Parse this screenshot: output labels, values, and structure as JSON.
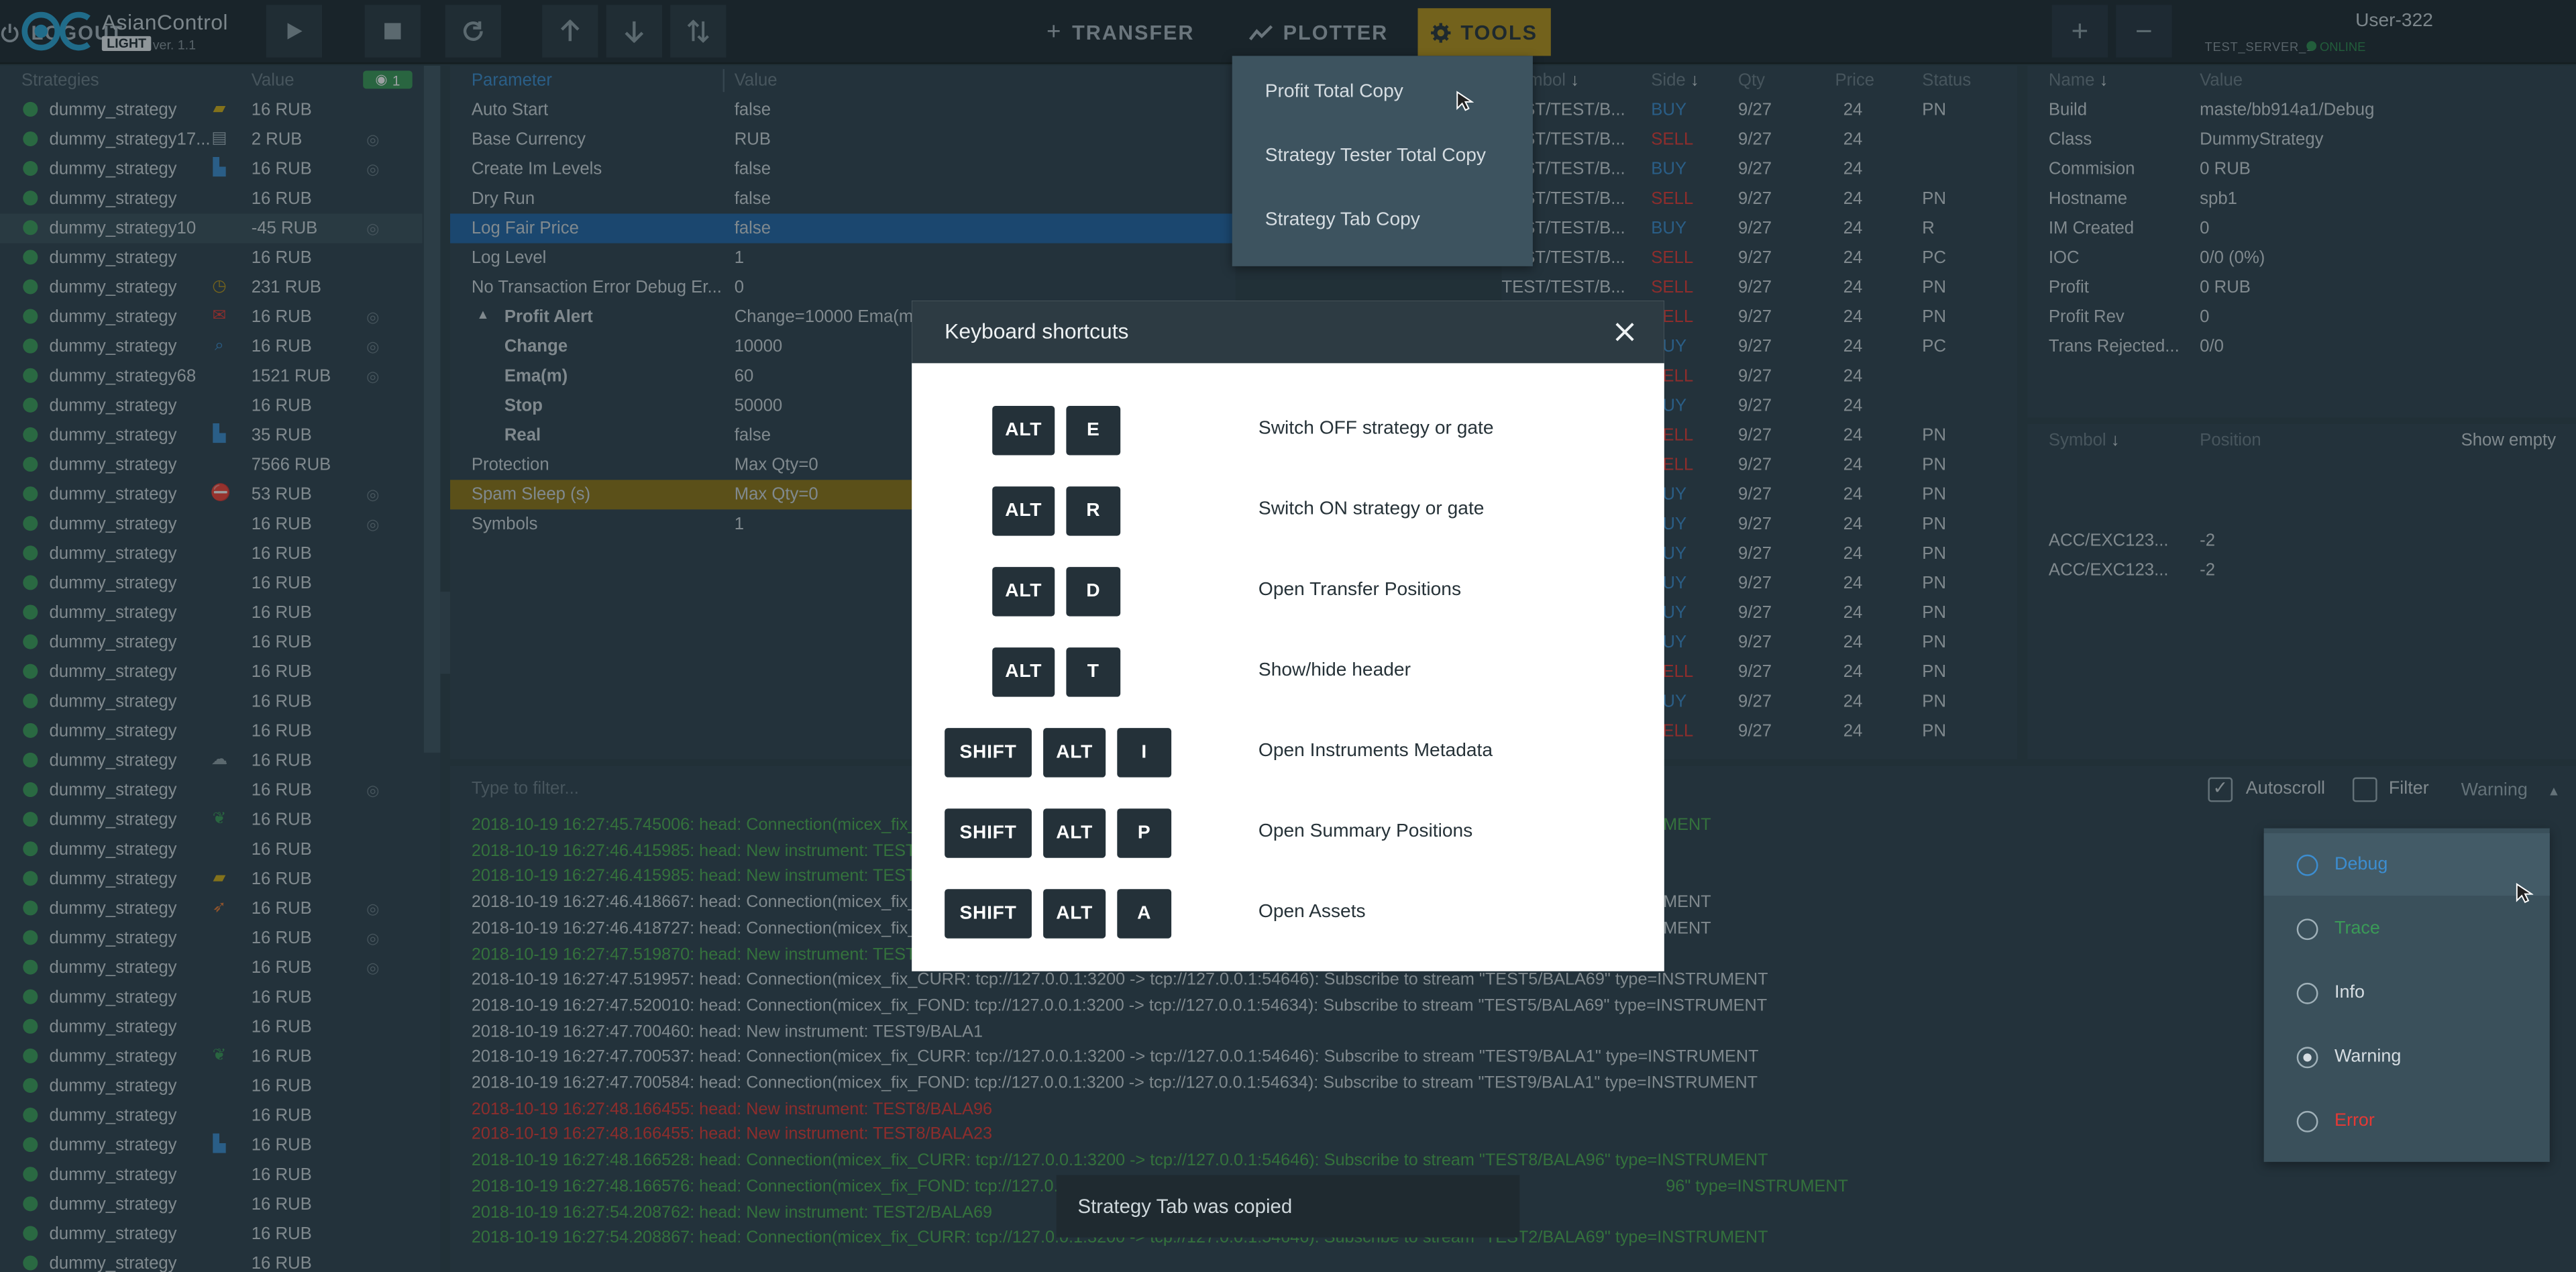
{
  "header": {
    "app_name": "AsianControl",
    "edition": "LIGHT",
    "version": "ver. 1.1",
    "nav": [
      {
        "label": "TRANSFER",
        "icon": "plus-icon"
      },
      {
        "label": "PLOTTER",
        "icon": "trend-icon"
      },
      {
        "label": "TOOLS",
        "icon": "gear-icon"
      }
    ],
    "user": "User-322",
    "server": "TEST_SERVER_1",
    "status": "ONLINE",
    "logout": "LOGOUT"
  },
  "strategies": {
    "col_name": "Strategies",
    "col_value": "Value",
    "visible_count": "1",
    "rows": [
      {
        "name": "dummy_strategy",
        "value": "16 RUB",
        "icon": "flag",
        "eye": false
      },
      {
        "name": "dummy_strategy17...",
        "value": "2 RUB",
        "icon": "chart",
        "eye": true
      },
      {
        "name": "dummy_strategy",
        "value": "16 RUB",
        "icon": "boot",
        "eye": true
      },
      {
        "name": "dummy_strategy",
        "value": "16 RUB",
        "icon": "",
        "eye": false
      },
      {
        "name": "dummy_strategy10",
        "value": "-45 RUB",
        "icon": "",
        "eye": true
      },
      {
        "name": "dummy_strategy",
        "value": "16 RUB",
        "icon": "",
        "eye": false
      },
      {
        "name": "dummy_strategy",
        "value": "231 RUB",
        "icon": "clock",
        "eye": false
      },
      {
        "name": "dummy_strategy",
        "value": "16 RUB",
        "icon": "mail",
        "eye": true
      },
      {
        "name": "dummy_strategy",
        "value": "16 RUB",
        "icon": "search",
        "eye": true
      },
      {
        "name": "dummy_strategy68",
        "value": "1521 RUB",
        "icon": "",
        "eye": true
      },
      {
        "name": "dummy_strategy",
        "value": "16 RUB",
        "icon": "",
        "eye": false
      },
      {
        "name": "dummy_strategy",
        "value": "35 RUB",
        "icon": "boot",
        "eye": false
      },
      {
        "name": "dummy_strategy",
        "value": "7566 RUB",
        "icon": "",
        "eye": false
      },
      {
        "name": "dummy_strategy",
        "value": "53 RUB",
        "icon": "stop",
        "eye": true
      },
      {
        "name": "dummy_strategy",
        "value": "16 RUB",
        "icon": "",
        "eye": true
      },
      {
        "name": "dummy_strategy",
        "value": "16 RUB",
        "icon": "",
        "eye": false
      },
      {
        "name": "dummy_strategy",
        "value": "16 RUB",
        "icon": "",
        "eye": false
      },
      {
        "name": "dummy_strategy",
        "value": "16 RUB",
        "icon": "",
        "eye": false
      },
      {
        "name": "dummy_strategy",
        "value": "16 RUB",
        "icon": "",
        "eye": false
      },
      {
        "name": "dummy_strategy",
        "value": "16 RUB",
        "icon": "",
        "eye": false
      },
      {
        "name": "dummy_strategy",
        "value": "16 RUB",
        "icon": "",
        "eye": false
      },
      {
        "name": "dummy_strategy",
        "value": "16 RUB",
        "icon": "",
        "eye": false
      },
      {
        "name": "dummy_strategy",
        "value": "16 RUB",
        "icon": "cloud",
        "eye": false
      },
      {
        "name": "dummy_strategy",
        "value": "16 RUB",
        "icon": "",
        "eye": true
      },
      {
        "name": "dummy_strategy",
        "value": "16 RUB",
        "icon": "leaf",
        "eye": false
      },
      {
        "name": "dummy_strategy",
        "value": "16 RUB",
        "icon": "",
        "eye": false
      },
      {
        "name": "dummy_strategy",
        "value": "16 RUB",
        "icon": "flag",
        "eye": false
      },
      {
        "name": "dummy_strategy",
        "value": "16 RUB",
        "icon": "rocket",
        "eye": true
      },
      {
        "name": "dummy_strategy",
        "value": "16 RUB",
        "icon": "",
        "eye": true
      },
      {
        "name": "dummy_strategy",
        "value": "16 RUB",
        "icon": "",
        "eye": true
      },
      {
        "name": "dummy_strategy",
        "value": "16 RUB",
        "icon": "",
        "eye": false
      },
      {
        "name": "dummy_strategy",
        "value": "16 RUB",
        "icon": "",
        "eye": false
      },
      {
        "name": "dummy_strategy",
        "value": "16 RUB",
        "icon": "leaf",
        "eye": false
      },
      {
        "name": "dummy_strategy",
        "value": "16 RUB",
        "icon": "",
        "eye": false
      },
      {
        "name": "dummy_strategy",
        "value": "16 RUB",
        "icon": "",
        "eye": false
      },
      {
        "name": "dummy_strategy",
        "value": "16 RUB",
        "icon": "boot",
        "eye": false
      },
      {
        "name": "dummy_strategy",
        "value": "16 RUB",
        "icon": "",
        "eye": false
      },
      {
        "name": "dummy_strategy",
        "value": "16 RUB",
        "icon": "",
        "eye": false
      },
      {
        "name": "dummy_strategy",
        "value": "16 RUB",
        "icon": "",
        "eye": false
      },
      {
        "name": "dummy_strategy",
        "value": "16 RUB",
        "icon": "",
        "eye": false
      }
    ]
  },
  "params": {
    "col_name": "Parameter",
    "col_value": "Value",
    "rows": [
      {
        "name": "Auto Start",
        "value": "false",
        "indent": 0,
        "hl": ""
      },
      {
        "name": "Base Currency",
        "value": "RUB",
        "indent": 0,
        "hl": ""
      },
      {
        "name": "Create Im Levels",
        "value": "false",
        "indent": 0,
        "hl": ""
      },
      {
        "name": "Dry Run",
        "value": "false",
        "indent": 0,
        "hl": ""
      },
      {
        "name": "Log Fair Price",
        "value": "false",
        "indent": 0,
        "hl": "blue"
      },
      {
        "name": "Log Level",
        "value": "1",
        "indent": 0,
        "hl": ""
      },
      {
        "name": "No Transaction Error Debug Er...",
        "value": "0",
        "indent": 0,
        "hl": ""
      },
      {
        "name": "Profit Alert",
        "value": "Change=10000 Ema(m)=60 S",
        "indent": 1,
        "hl": "",
        "bold": true
      },
      {
        "name": "Change",
        "value": "10000",
        "indent": 2,
        "hl": "",
        "bold": true
      },
      {
        "name": "Ema(m)",
        "value": "60",
        "indent": 2,
        "hl": "",
        "bold": true
      },
      {
        "name": "Stop",
        "value": "50000",
        "indent": 2,
        "hl": "",
        "bold": true
      },
      {
        "name": "Real",
        "value": "false",
        "indent": 2,
        "hl": "",
        "bold": true
      },
      {
        "name": "Protection",
        "value": "Max Qty=0",
        "indent": 0,
        "hl": ""
      },
      {
        "name": "Spam Sleep (s)",
        "value": "Max Qty=0",
        "indent": 0,
        "hl": "yellow"
      },
      {
        "name": "Symbols",
        "value": "1",
        "indent": 0,
        "hl": ""
      }
    ]
  },
  "orders": {
    "cols": [
      "Symbol",
      "Side",
      "Qty",
      "Price",
      "Status"
    ],
    "symbol": "TEST/TEST/B...",
    "rows": [
      {
        "side": "BUY",
        "qty": "9/27",
        "price": "24",
        "status": "PN"
      },
      {
        "side": "SELL",
        "qty": "9/27",
        "price": "24",
        "status": ""
      },
      {
        "side": "BUY",
        "qty": "9/27",
        "price": "24",
        "status": ""
      },
      {
        "side": "SELL",
        "qty": "9/27",
        "price": "24",
        "status": "PN"
      },
      {
        "side": "BUY",
        "qty": "9/27",
        "price": "24",
        "status": "R"
      },
      {
        "side": "SELL",
        "qty": "9/27",
        "price": "24",
        "status": "PC"
      },
      {
        "side": "SELL",
        "qty": "9/27",
        "price": "24",
        "status": "PN"
      },
      {
        "side": "SELL",
        "qty": "9/27",
        "price": "24",
        "status": "PN"
      },
      {
        "side": "BUY",
        "qty": "9/27",
        "price": "24",
        "status": "PC"
      },
      {
        "side": "SELL",
        "qty": "9/27",
        "price": "24",
        "status": ""
      },
      {
        "side": "BUY",
        "qty": "9/27",
        "price": "24",
        "status": ""
      },
      {
        "side": "SELL",
        "qty": "9/27",
        "price": "24",
        "status": "PN"
      },
      {
        "side": "SELL",
        "qty": "9/27",
        "price": "24",
        "status": "PN"
      },
      {
        "side": "BUY",
        "qty": "9/27",
        "price": "24",
        "status": "PN"
      },
      {
        "side": "BUY",
        "qty": "9/27",
        "price": "24",
        "status": "PN"
      },
      {
        "side": "BUY",
        "qty": "9/27",
        "price": "24",
        "status": "PN"
      },
      {
        "side": "BUY",
        "qty": "9/27",
        "price": "24",
        "status": "PN"
      },
      {
        "side": "BUY",
        "qty": "9/27",
        "price": "24",
        "status": "PN"
      },
      {
        "side": "BUY",
        "qty": "9/27",
        "price": "24",
        "status": "PN"
      },
      {
        "side": "SELL",
        "qty": "9/27",
        "price": "24",
        "status": "PN"
      },
      {
        "side": "BUY",
        "qty": "9/27",
        "price": "24",
        "status": "PN"
      },
      {
        "side": "SELL",
        "qty": "9/27",
        "price": "24",
        "status": "PN"
      }
    ]
  },
  "info": {
    "col_name": "Name",
    "col_value": "Value",
    "rows": [
      {
        "name": "Build",
        "value": "maste/bb914a1/Debug"
      },
      {
        "name": "Class",
        "value": "DummyStrategy"
      },
      {
        "name": "Commision",
        "value": "0 RUB"
      },
      {
        "name": "Hostname",
        "value": "spb1"
      },
      {
        "name": "IM Created",
        "value": "0"
      },
      {
        "name": "IOC",
        "value": "0/0 (0%)"
      },
      {
        "name": "Profit",
        "value": "0 RUB"
      },
      {
        "name": "Profit Rev",
        "value": "0"
      },
      {
        "name": "Trans Rejected...",
        "value": "0/0"
      }
    ]
  },
  "positions": {
    "col_symbol": "Symbol",
    "col_position": "Position",
    "show_empty": "Show empty",
    "rows": [
      {
        "symbol": "ACC/EXC123...",
        "position": "-2"
      },
      {
        "symbol": "ACC/EXC123...",
        "position": "-2"
      }
    ]
  },
  "logs": {
    "filter_placeholder": "Type to filter...",
    "autoscroll": "Autoscroll",
    "filter": "Filter",
    "level": "Warning",
    "lines": [
      {
        "text": "2018-10-19 16:27:45.745006: head: Connection(micex_fix_FO",
        "tail": "INSTRUMENT",
        "color": "#4caf50"
      },
      {
        "text": "2018-10-19 16:27:46.415985: head: New instrument: TEST1/",
        "tail": "",
        "color": "#4caf50"
      },
      {
        "text": "2018-10-19 16:27:46.415985: head: New instrument: TEST1/",
        "tail": "",
        "color": "#4caf50"
      },
      {
        "text": "2018-10-19 16:27:46.418667: head: Connection(micex_fix_CU",
        "tail": "INSTRUMENT",
        "color": "#cfd8dc"
      },
      {
        "text": "2018-10-19 16:27:46.418727: head: Connection(micex_fix_FO",
        "tail": "INSTRUMENT",
        "color": "#cfd8dc"
      },
      {
        "text": "2018-10-19 16:27:47.519870: head: New instrument: TEST5/",
        "tail": "",
        "color": "#4caf50"
      },
      {
        "text": "2018-10-19 16:27:47.519957: head: Connection(micex_fix_CURR: tcp://127.0.0.1:3200 -> tcp://127.0.0.1:54646): Subscribe to stream \"TEST5/BALA69\" type=INSTRUMENT",
        "tail": "",
        "color": "#cfd8dc"
      },
      {
        "text": "2018-10-19 16:27:47.520010: head: Connection(micex_fix_FOND: tcp://127.0.0.1:3200 -> tcp://127.0.0.1:54634): Subscribe to stream \"TEST5/BALA69\" type=INSTRUMENT",
        "tail": "",
        "color": "#cfd8dc"
      },
      {
        "text": "2018-10-19 16:27:47.700460: head: New instrument: TEST9/BALA1",
        "tail": "",
        "color": "#cfd8dc"
      },
      {
        "text": "2018-10-19 16:27:47.700537: head: Connection(micex_fix_CURR: tcp://127.0.0.1:3200 -> tcp://127.0.0.1:54646): Subscribe to stream \"TEST9/BALA1\" type=INSTRUMENT",
        "tail": "",
        "color": "#cfd8dc"
      },
      {
        "text": "2018-10-19 16:27:47.700584: head: Connection(micex_fix_FOND: tcp://127.0.0.1:3200 -> tcp://127.0.0.1:54634): Subscribe to stream \"TEST9/BALA1\" type=INSTRUMENT",
        "tail": "",
        "color": "#cfd8dc"
      },
      {
        "text": "2018-10-19 16:27:48.166455: head: New instrument: TEST8/BALA96",
        "tail": "",
        "color": "#e53935"
      },
      {
        "text": "2018-10-19 16:27:48.166455: head: New instrument: TEST8/BALA23",
        "tail": "",
        "color": "#e53935"
      },
      {
        "text": "2018-10-19 16:27:48.166528: head: Connection(micex_fix_CURR: tcp://127.0.0.1:3200 -> tcp://127.0.0.1:54646): Subscribe to stream \"TEST8/BALA96\" type=INSTRUMENT",
        "tail": "",
        "color": "#4caf50"
      },
      {
        "text": "2018-10-19 16:27:48.166576: head: Connection(micex_fix_FOND: tcp://127.0.0.1",
        "tail": "96\" type=INSTRUMENT",
        "color": "#4caf50"
      },
      {
        "text": "2018-10-19 16:27:54.208762: head: New instrument: TEST2/BALA69",
        "tail": "",
        "color": "#4caf50"
      },
      {
        "text": "2018-10-19 16:27:54.208867: head: Connection(micex_fix_CURR: tcp://127.0.0.1:3200 -> tcp://127.0.0.1:54646): Subscribe to stream \"TEST2/BALA69\" type=INSTRUMENT",
        "tail": "",
        "color": "#4caf50"
      }
    ]
  },
  "tools_menu": {
    "items": [
      "Profit Total Copy",
      "Strategy Tester Total Copy",
      "Strategy Tab Copy"
    ]
  },
  "level_menu": {
    "items": [
      {
        "label": "Debug",
        "color": "#3c8dd0",
        "selected": false,
        "hover": true
      },
      {
        "label": "Trace",
        "color": "#3a9a57",
        "selected": false,
        "hover": false
      },
      {
        "label": "Info",
        "color": "#d6dde2",
        "selected": false,
        "hover": false
      },
      {
        "label": "Warning",
        "color": "#d6dde2",
        "selected": true,
        "hover": false
      },
      {
        "label": "Error",
        "color": "#e53935",
        "selected": false,
        "hover": false
      }
    ]
  },
  "modal": {
    "title": "Keyboard shortcuts",
    "shortcuts": [
      {
        "keys": [
          "ALT",
          "E"
        ],
        "desc": "Switch OFF strategy or gate"
      },
      {
        "keys": [
          "ALT",
          "R"
        ],
        "desc": "Switch ON strategy or gate"
      },
      {
        "keys": [
          "ALT",
          "D"
        ],
        "desc": "Open Transfer Positions"
      },
      {
        "keys": [
          "ALT",
          "T"
        ],
        "desc": "Show/hide header"
      },
      {
        "keys": [
          "SHIFT",
          "ALT",
          "I"
        ],
        "desc": "Open Instruments Metadata"
      },
      {
        "keys": [
          "SHIFT",
          "ALT",
          "P"
        ],
        "desc": "Open Summary Positions"
      },
      {
        "keys": [
          "SHIFT",
          "ALT",
          "A"
        ],
        "desc": "Open Assets"
      }
    ]
  },
  "toast": {
    "text": "Strategy Tab was copied"
  },
  "colors": {
    "buy": "#3c8dd0",
    "sell": "#e53935",
    "accent": "#b89519",
    "online": "#2d8c4e"
  }
}
